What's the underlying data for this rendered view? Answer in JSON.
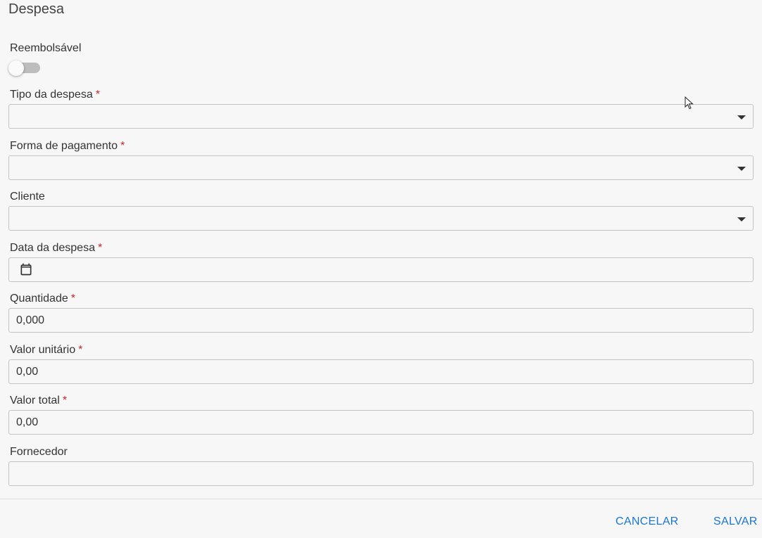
{
  "dialog": {
    "title": "Despesa"
  },
  "reembolsavel": {
    "label": "Reembolsável",
    "enabled": false
  },
  "required_marker": "*",
  "fields": {
    "tipo_despesa": {
      "label": "Tipo da despesa",
      "required": true,
      "value": ""
    },
    "forma_pagamento": {
      "label": "Forma de pagamento",
      "required": true,
      "value": ""
    },
    "cliente": {
      "label": "Cliente",
      "required": false,
      "value": ""
    },
    "data_despesa": {
      "label": "Data da despesa",
      "required": true,
      "value": "",
      "icon": "calendar-icon"
    },
    "quantidade": {
      "label": "Quantidade",
      "required": true,
      "value": "0,000"
    },
    "valor_unitario": {
      "label": "Valor unitário",
      "required": true,
      "value": "0,00"
    },
    "valor_total": {
      "label": "Valor total",
      "required": true,
      "value": "0,00"
    },
    "fornecedor": {
      "label": "Fornecedor",
      "required": false,
      "value": ""
    }
  },
  "actions": {
    "cancel_label": "CANCELAR",
    "save_label": "SALVAR"
  },
  "colors": {
    "accent": "#1976d2",
    "required": "#c62828",
    "border": "#c4c4c4"
  }
}
